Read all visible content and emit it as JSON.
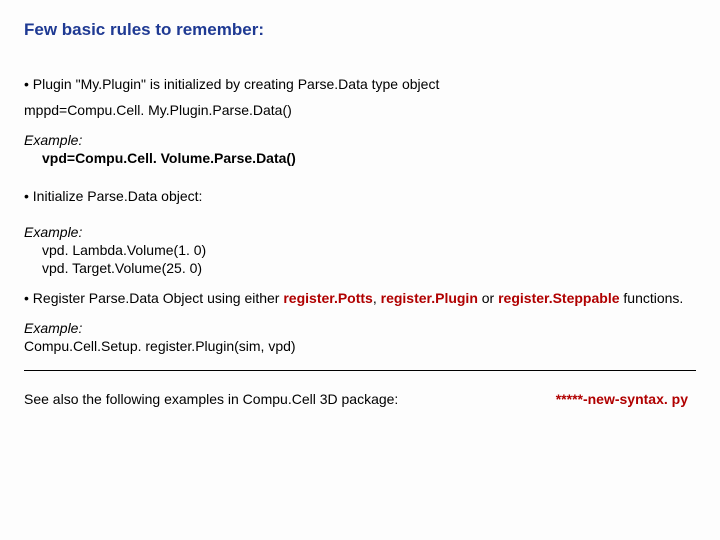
{
  "title": "Few basic rules to remember:",
  "bullet1": "• Plugin \"My.Plugin\" is initialized by creating Parse.Data type object",
  "code1": "mppd=Compu.Cell. My.Plugin.Parse.Data()",
  "example_label": "Example:",
  "example1_body": "vpd=Compu.Cell. Volume.Parse.Data()",
  "bullet2": "• Initialize Parse.Data object:",
  "example2_line1": "vpd. Lambda.Volume(1. 0)",
  "example2_line2": "vpd. Target.Volume(25. 0)",
  "reg_prefix": "• Register Parse.Data Object using either ",
  "reg_fn1": "register.Potts",
  "reg_sep1": ", ",
  "reg_fn2": "register.Plugin",
  "reg_sep2": " or ",
  "reg_fn3": "register.Steppable",
  "reg_suffix": " functions.",
  "example3_line": "Compu.Cell.Setup. register.Plugin(sim, vpd)",
  "footer_left": "See also the following examples in Compu.Cell 3D package:",
  "footer_right": "*****-new-syntax. py"
}
